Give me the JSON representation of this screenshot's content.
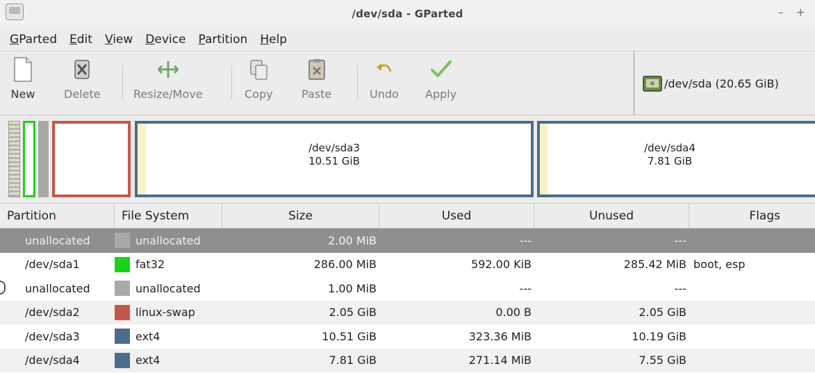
{
  "window": {
    "title": "/dev/sda - GParted",
    "controls": {
      "minimize": "–",
      "maximize": "+"
    }
  },
  "menubar": {
    "items": [
      {
        "label_u": "G",
        "label_rest": "Parted"
      },
      {
        "label_u": "E",
        "label_rest": "dit"
      },
      {
        "label_u": "V",
        "label_rest": "iew"
      },
      {
        "label_u": "D",
        "label_rest": "evice"
      },
      {
        "label_u": "P",
        "label_rest": "artition"
      },
      {
        "label_u": "H",
        "label_rest": "elp"
      }
    ]
  },
  "toolbar": {
    "new": {
      "label": "New",
      "icon": "new-document-icon"
    },
    "delete": {
      "label": "Delete",
      "icon": "delete-icon"
    },
    "resize": {
      "label": "Resize/Move",
      "icon": "resize-move-icon"
    },
    "copy": {
      "label": "Copy",
      "icon": "copy-icon"
    },
    "paste": {
      "label": "Paste",
      "icon": "paste-icon"
    },
    "undo": {
      "label": "Undo",
      "icon": "undo-icon"
    },
    "apply": {
      "label": "Apply",
      "icon": "apply-checkmark-icon"
    }
  },
  "device_selector": {
    "text": "/dev/sda  (20.65 GiB)",
    "icon": "harddisk-icon"
  },
  "diskmap": {
    "sda3": {
      "name": "/dev/sda3",
      "size": "10.51 GiB"
    },
    "sda4": {
      "name": "/dev/sda4",
      "size": "7.81 GiB"
    }
  },
  "table": {
    "headers": {
      "partition": "Partition",
      "filesystem": "File System",
      "size": "Size",
      "used": "Used",
      "unused": "Unused",
      "flags": "Flags"
    },
    "rows": [
      {
        "partition": "unallocated",
        "fs": "unallocated",
        "size": "2.00 MiB",
        "used": "---",
        "unused": "---",
        "flags": ""
      },
      {
        "partition": "/dev/sda1",
        "fs": "fat32",
        "size": "286.00 MiB",
        "used": "592.00 KiB",
        "unused": "285.42 MiB",
        "flags": "boot, esp"
      },
      {
        "partition": "unallocated",
        "fs": "unallocated",
        "size": "1.00 MiB",
        "used": "---",
        "unused": "---",
        "flags": ""
      },
      {
        "partition": "/dev/sda2",
        "fs": "linux-swap",
        "size": "2.05 GiB",
        "used": "0.00 B",
        "unused": "2.05 GiB",
        "flags": ""
      },
      {
        "partition": "/dev/sda3",
        "fs": "ext4",
        "size": "10.51 GiB",
        "used": "323.36 MiB",
        "unused": "10.19 GiB",
        "flags": ""
      },
      {
        "partition": "/dev/sda4",
        "fs": "ext4",
        "size": "7.81 GiB",
        "used": "271.14 MiB",
        "unused": "7.55 GiB",
        "flags": ""
      }
    ]
  },
  "colors": {
    "unallocated": "#a9a9a9",
    "fat32": "#19d219",
    "linux_swap": "#c4574b",
    "ext4": "#4b6c8b",
    "selected_row": "#8f8f8f",
    "used_space": "#f7f5c8"
  }
}
